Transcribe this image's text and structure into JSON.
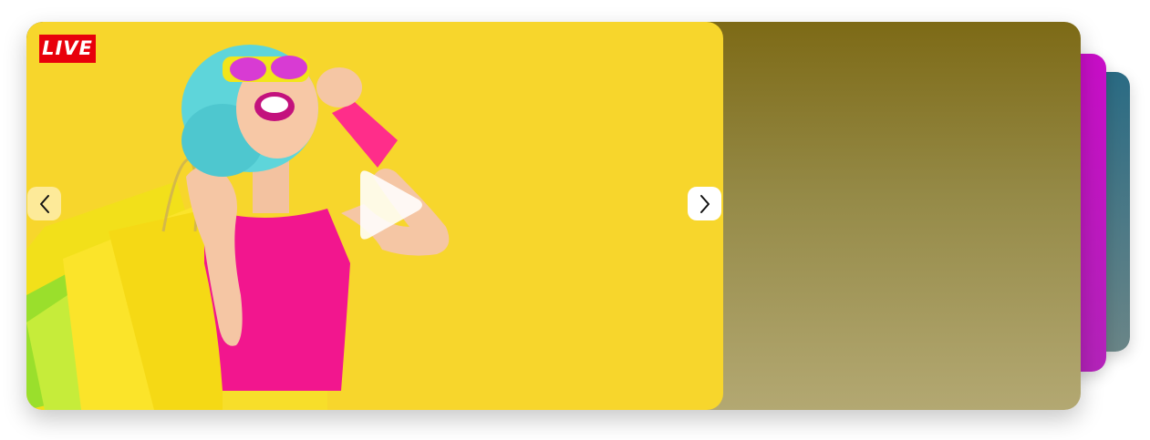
{
  "carousel": {
    "badge": "LIVE",
    "prev_icon": "chevron-left-icon",
    "next_icon": "chevron-right-icon",
    "play_icon": "play-icon",
    "colors": {
      "panel_bg": "#f7d62c",
      "badge_bg": "#e8000b",
      "side_gradient_top": "#7d6a16",
      "side_gradient_bottom": "#b3a872",
      "stack_card_1": "#c90ec8",
      "stack_card_2": "#2a6b84"
    }
  }
}
